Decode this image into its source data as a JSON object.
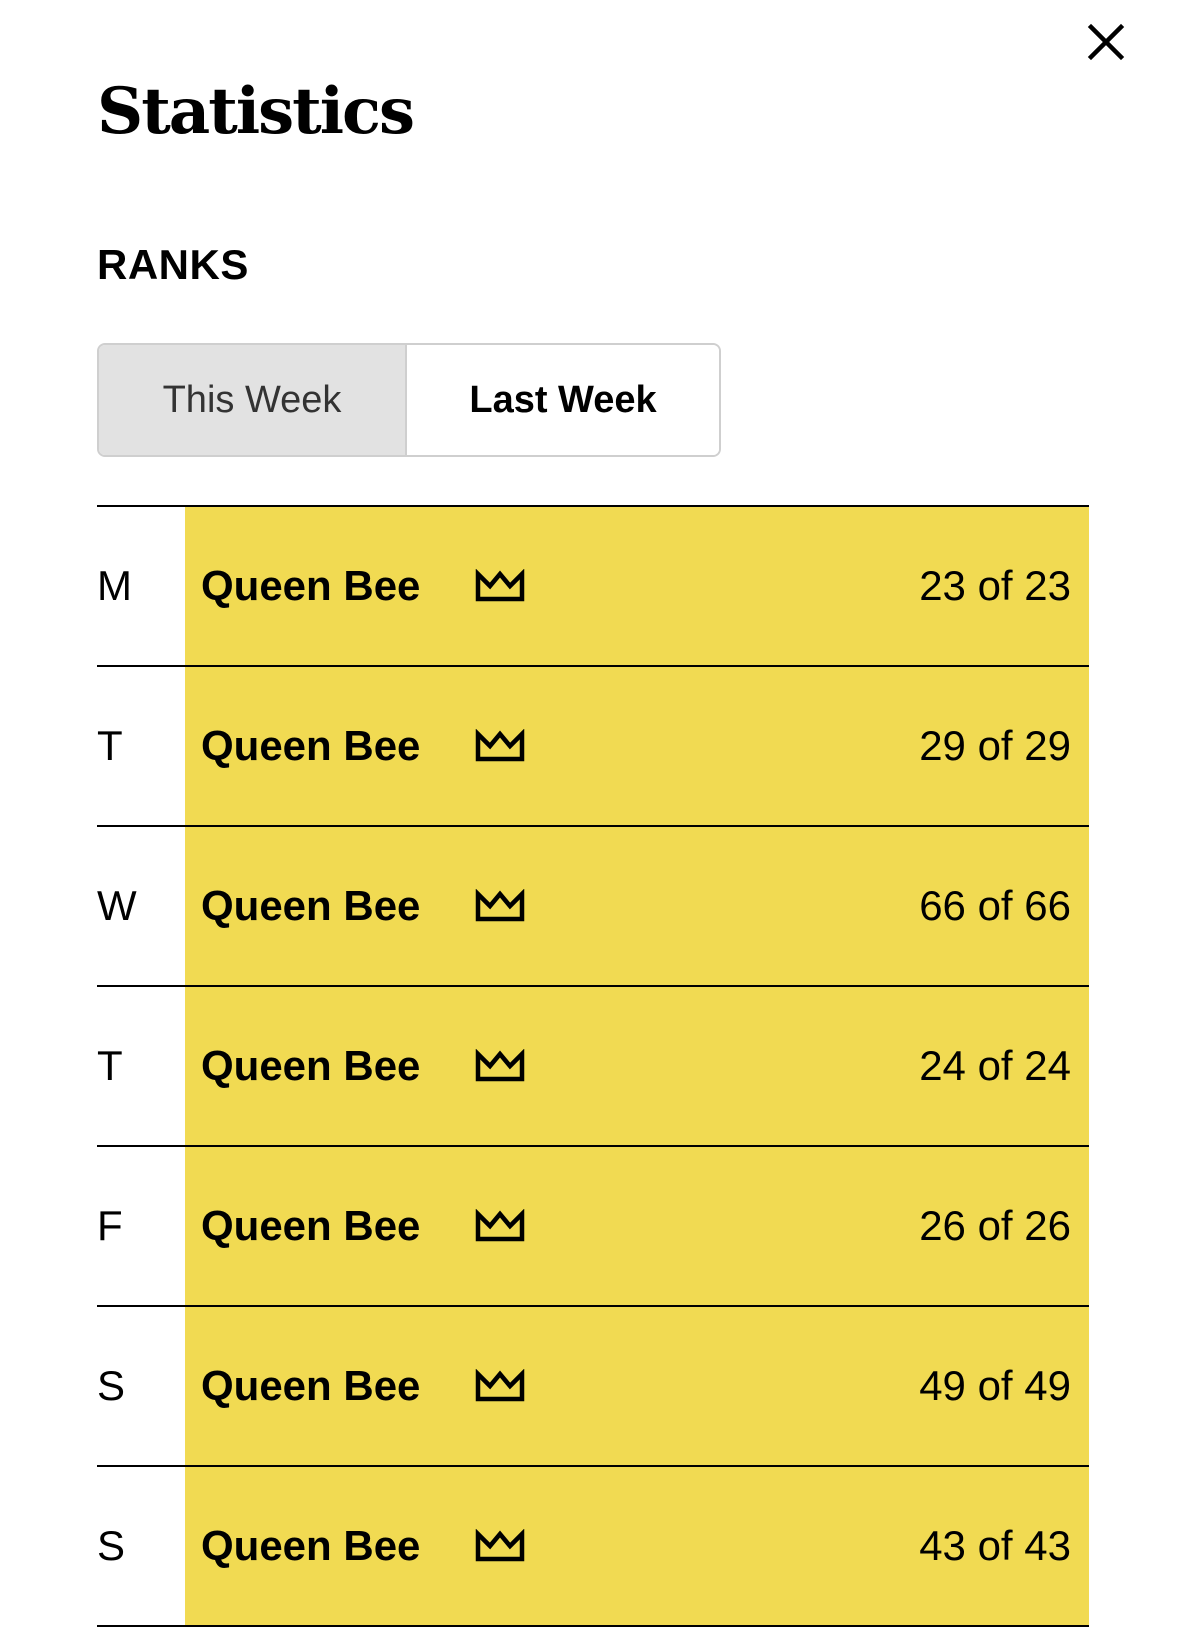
{
  "header": {
    "title": "Statistics",
    "close_icon": "close-icon"
  },
  "ranks_section": {
    "label": "RANKS",
    "tabs": [
      {
        "label": "This Week",
        "selected": false
      },
      {
        "label": "Last Week",
        "selected": true
      }
    ]
  },
  "rows": [
    {
      "day": "M",
      "rank": "Queen Bee",
      "icon": "crown-icon",
      "score": "23 of 23"
    },
    {
      "day": "T",
      "rank": "Queen Bee",
      "icon": "crown-icon",
      "score": "29 of 29"
    },
    {
      "day": "W",
      "rank": "Queen Bee",
      "icon": "crown-icon",
      "score": "66 of 66"
    },
    {
      "day": "T",
      "rank": "Queen Bee",
      "icon": "crown-icon",
      "score": "24 of 24"
    },
    {
      "day": "F",
      "rank": "Queen Bee",
      "icon": "crown-icon",
      "score": "26 of 26"
    },
    {
      "day": "S",
      "rank": "Queen Bee",
      "icon": "crown-icon",
      "score": "49 of 49"
    },
    {
      "day": "S",
      "rank": "Queen Bee",
      "icon": "crown-icon",
      "score": "43 of 43"
    }
  ],
  "colors": {
    "rank_highlight": "#f1da52",
    "tab_inactive": "#e2e2e2",
    "divider": "#000000"
  }
}
